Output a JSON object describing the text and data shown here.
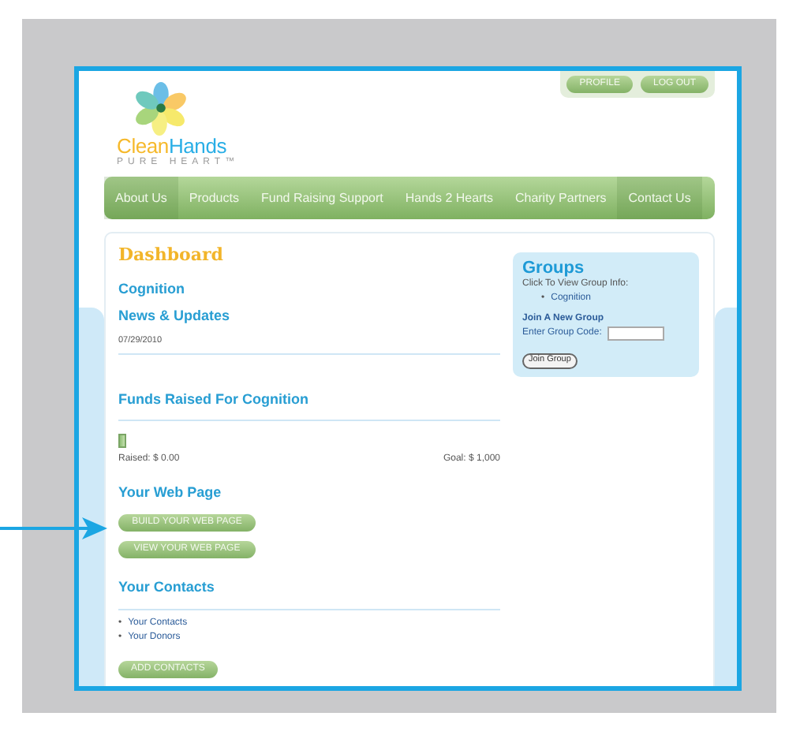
{
  "header": {
    "logo_name": "Clean",
    "logo_name_accent": "Hands",
    "logo_tagline": "PURE HEART™",
    "account_buttons": [
      "PROFILE",
      "LOG OUT"
    ]
  },
  "nav": [
    "About Us",
    "Products",
    "Fund Raising Support",
    "Hands 2 Hearts",
    "Charity Partners",
    "Contact Us"
  ],
  "dashboard": {
    "title": "Dashboard",
    "group_name": "Cognition",
    "news_heading": "News & Updates",
    "news_date": "07/29/2010",
    "funds_heading": "Funds Raised For Cognition",
    "funds_bar": {
      "level": 0
    },
    "raised": "Raised: $ 0.00",
    "goal": "Goal: $ 1,000",
    "web_heading": "Your Web Page",
    "web_buttons": [
      "BUILD YOUR WEB PAGE",
      "VIEW YOUR WEB PAGE"
    ],
    "contacts_heading": "Your Contacts",
    "contact_links": [
      {
        "bullet": "•",
        "label": "Your Contacts"
      },
      {
        "bullet": "•",
        "label": "Your Donors"
      }
    ],
    "contacts_button": "ADD CONTACTS"
  },
  "groups": {
    "title": "Groups",
    "hint": "Click To View Group Info:",
    "items": [
      {
        "bullet": "•",
        "label": "Cognition"
      }
    ],
    "join_heading": "Join A New Group",
    "code_label": "Enter Group Code:",
    "join_button": "Join Group"
  }
}
